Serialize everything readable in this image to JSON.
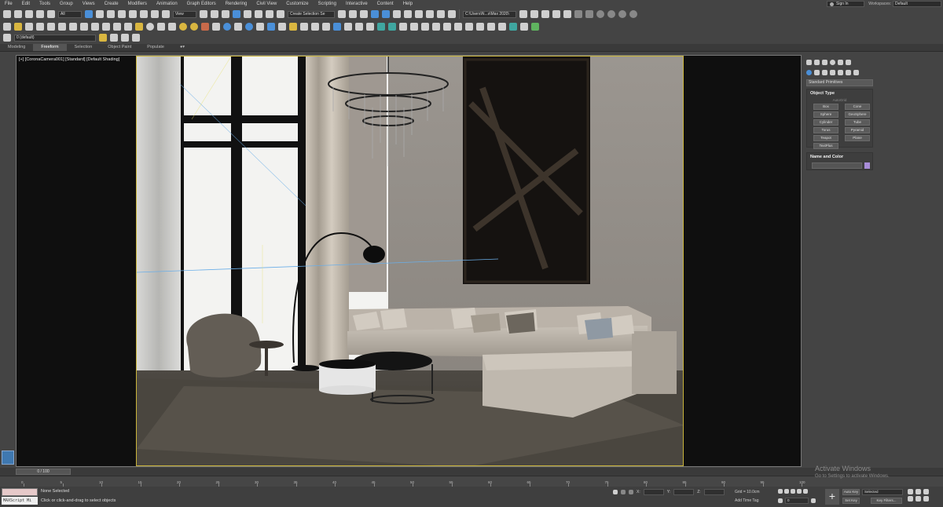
{
  "menu": [
    "File",
    "Edit",
    "Tools",
    "Group",
    "Views",
    "Create",
    "Modifiers",
    "Animation",
    "Graph Editors",
    "Rendering",
    "Civil View",
    "Customize",
    "Scripting",
    "Interactive",
    "Content",
    "Help"
  ],
  "account": {
    "signin": "Sign In",
    "workspaces_label": "Workspaces:",
    "workspace": "Default"
  },
  "toolbar": {
    "filter": "All",
    "refcoord": "View",
    "selection_set": "Create Selection Se",
    "project_path": "C:\\Users\\N...s\\Max 2020\\",
    "layer": "0 (default)"
  },
  "ribbon_tabs": [
    "Modeling",
    "Freeform",
    "Selection",
    "Object Paint",
    "Populate"
  ],
  "viewport": {
    "label": "[+] [CoronaCamera001] [Standard] [Default Shading]"
  },
  "command_panel": {
    "category": "Standard Primitives",
    "object_type_title": "Object Type",
    "autogrid": "AutoGrid",
    "buttons": [
      "Box",
      "Cone",
      "Sphere",
      "GeoSphere",
      "Cylinder",
      "Tube",
      "Torus",
      "Pyramid",
      "Teapot",
      "Plane",
      "TextPlus"
    ],
    "name_color_title": "Name and Color"
  },
  "timeline": {
    "slider": "0 / 100",
    "ticks": [
      "0",
      "5",
      "10",
      "15",
      "20",
      "25",
      "30",
      "35",
      "40",
      "45",
      "50",
      "55",
      "60",
      "65",
      "70",
      "75",
      "80",
      "85",
      "90",
      "95",
      "100"
    ]
  },
  "status": {
    "maxscript": "MAXScript Mi",
    "selection": "None Selected",
    "prompt": "Click or click-and-drag to select objects",
    "x_label": "X:",
    "y_label": "Y:",
    "z_label": "Z:",
    "grid": "Grid = 10.0cm",
    "add_time_tag": "Add Time Tag",
    "auto_key": "Auto Key",
    "set_key": "Set Key",
    "selected": "Selected",
    "key_filters": "Key Filters...",
    "frame": "0"
  },
  "watermark": {
    "line1": "Activate Windows",
    "line2": "Go to Settings to activate Windows."
  }
}
